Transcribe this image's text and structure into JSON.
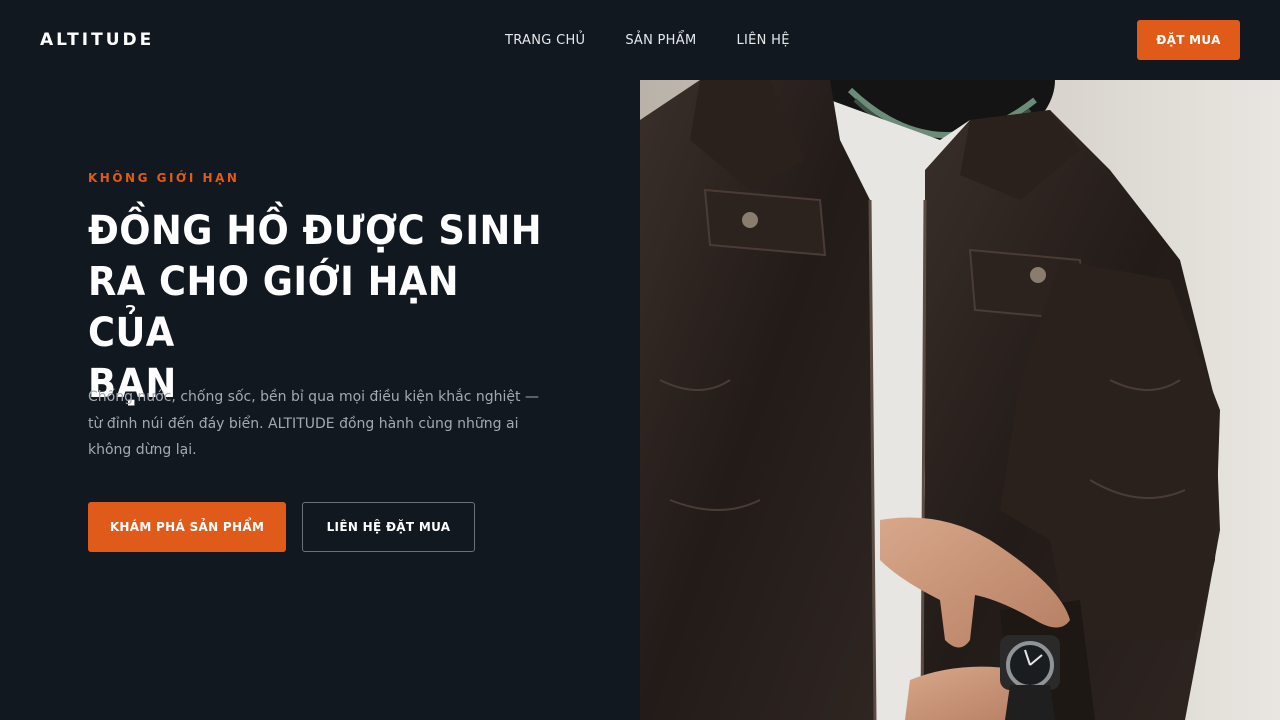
{
  "brand": {
    "logo": "ALTITUDE",
    "accent_color": "#e05a1a",
    "background_color": "#121820"
  },
  "nav": {
    "items": [
      {
        "label": "TRANG CHỦ"
      },
      {
        "label": "SẢN PHẨM"
      },
      {
        "label": "LIÊN HỆ"
      }
    ],
    "cta_label": "ĐẶT MUA"
  },
  "hero": {
    "eyebrow": "KHÔNG GIỚI HẠN",
    "headline_line1": "ĐỒNG HỒ ĐƯỢC SINH",
    "headline_line2": "RA CHO GIỚI HẠN CỦA",
    "headline_line3": "BẠN",
    "description": "Chống nước, chống sốc, bền bỉ qua mọi điều kiện khắc nghiệt — từ đỉnh núi đến đáy biển. ALTITUDE đồng hành cùng những ai không dừng lại.",
    "primary_button": "KHÁM PHÁ SẢN PHẨM",
    "secondary_button": "LIÊN HỆ ĐẶT MUA"
  }
}
